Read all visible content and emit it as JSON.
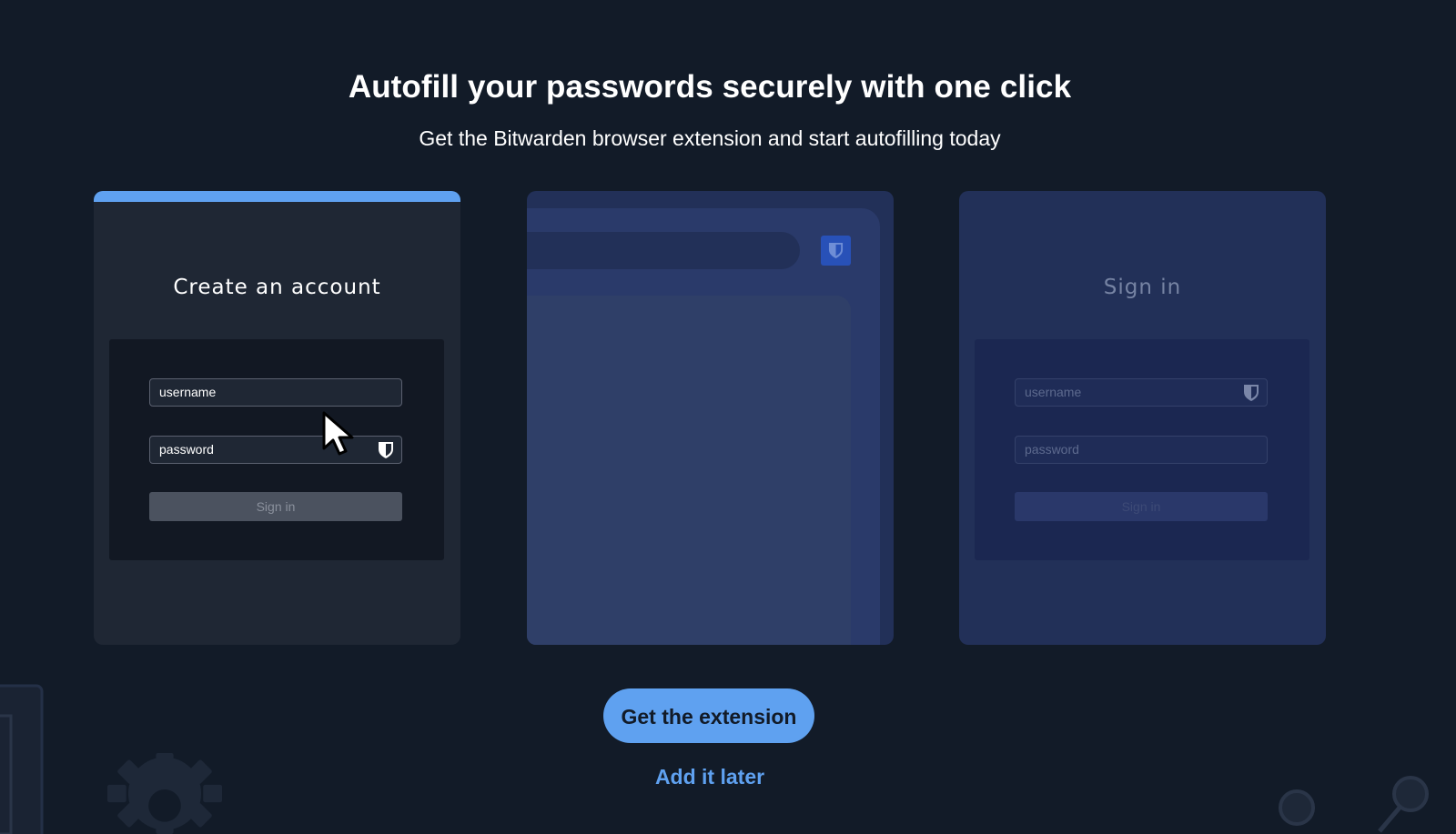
{
  "header": {
    "title": "Autofill your passwords securely with one click",
    "subtitle": "Get the Bitwarden browser extension and start autofilling today"
  },
  "cards": [
    {
      "title": "Create an account",
      "username_placeholder": "username",
      "password_placeholder": "password",
      "signin_label": "Sign in",
      "active": true
    },
    {
      "title": "",
      "extension_icon": "bitwarden-shield-icon"
    },
    {
      "title": "Sign in",
      "username_placeholder": "username",
      "password_placeholder": "password",
      "signin_label": "Sign in"
    }
  ],
  "actions": {
    "primary_label": "Get the extension",
    "secondary_label": "Add it later"
  },
  "colors": {
    "background": "#121b28",
    "accent": "#5fa1f0",
    "card_dark": "#1f2734",
    "card_blue": "#223058"
  }
}
